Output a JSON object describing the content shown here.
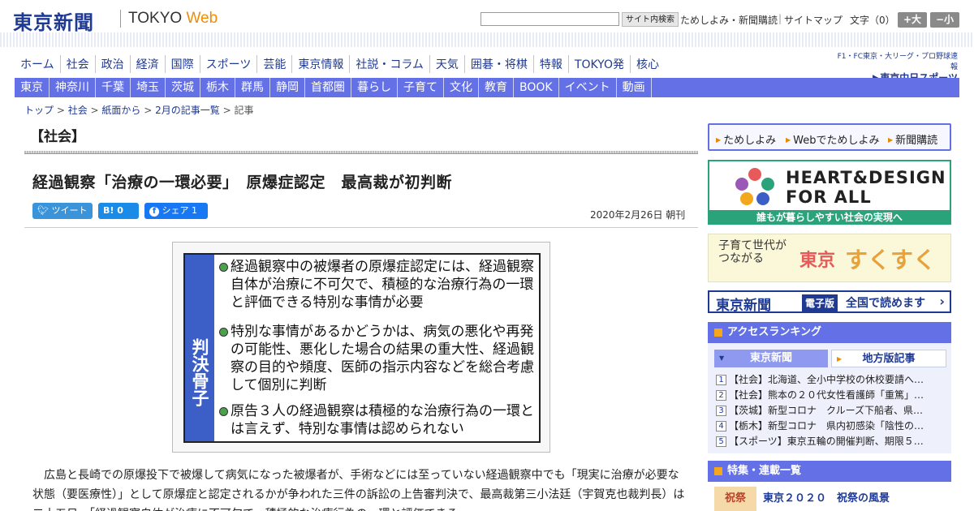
{
  "header": {
    "logo_jp": "東京新聞",
    "logo_en_prefix": "TOKYO ",
    "logo_en_suffix": "Web",
    "search_placeholder": "",
    "search_button": "サイト内検索",
    "links": [
      "ためしよみ・新聞購読",
      "サイトマップ"
    ],
    "font_size_label": "文字（0）",
    "font_plus": "+大",
    "font_minus": "−小"
  },
  "main_nav": [
    "ホーム",
    "社会",
    "政治",
    "経済",
    "国際",
    "スポーツ",
    "芸能",
    "東京情報",
    "社説・コラム",
    "天気",
    "囲碁・将棋",
    "特報",
    "TOKYO発",
    "核心"
  ],
  "chunichi": {
    "line1": "F1・FC東京・大リーグ・プロ野球速報",
    "line2": "▶東京中日スポーツ"
  },
  "sub_nav": [
    "東京",
    "神奈川",
    "千葉",
    "埼玉",
    "茨城",
    "栃木",
    "群馬",
    "静岡",
    "首都圏",
    "暮らし",
    "子育て",
    "文化",
    "教育",
    "BOOK",
    "イベント",
    "動画"
  ],
  "breadcrumb": [
    "トップ",
    "社会",
    "紙面から",
    "2月の記事一覧",
    "記事"
  ],
  "section_title": "【社会】",
  "article": {
    "headline": "経過観察「治療の一環必要」　原爆症認定　最高裁が初判断",
    "share": {
      "tweet": "ツイート",
      "hatena": "B! 0",
      "facebook": "シェア 1"
    },
    "date": "2020年2月26日 朝刊",
    "figure": {
      "side_label": "判決骨子",
      "points": [
        "経過観察中の被爆者の原爆症認定には、経過観察自体が治療に不可欠で、積極的な治療行為の一環と評価できる特別な事情が必要",
        "特別な事情があるかどうかは、病気の悪化や再発の可能性、悪化した場合の結果の重大性、経過観察の目的や頻度、医師の指示内容などを総合考慮して個別に判断",
        "原告３人の経過観察は積極的な治療行為の一環とは言えず、特別な事情は認められない"
      ]
    },
    "body": "　広島と長崎での原爆投下で被爆して病気になった被爆者が、手術などには至っていない経過観察中でも「現実に治療が必要な状態（要医療性）」として原爆症と認定されるかが争われた三件の訴訟の上告審判決で、最高裁第三小法廷（宇賀克也裁判長）は二十五日、「経過観察自体が治療に不可欠で、積極的な治療行為の一環と評価できる"
  },
  "rail": {
    "tameshi": [
      "ためしよみ",
      "Webでためしよみ",
      "新聞購読"
    ],
    "heart": {
      "title": "HEART&DESIGN FOR ALL",
      "caption": "誰もが暮らしやすい社会の実現へ"
    },
    "sukusuku": {
      "lead": "子育て世代が\nつながる",
      "tokyo": "東京",
      "main": "すくすく"
    },
    "denshi": {
      "name": "東京新聞",
      "badge": "電子版",
      "read": "全国で読めます"
    },
    "ranking": {
      "title": "アクセスランキング",
      "tab_active": "東京新聞",
      "tab_other": "地方版記事",
      "items": [
        "【社会】北海道、全小中学校の休校要請へ…",
        "【社会】熊本の２０代女性看護師「重篤」…",
        "【茨城】新型コロナ　クルーズ下船者、県…",
        "【栃木】新型コロナ　県内初感染「陰性の…",
        "【スポーツ】東京五輪の開催判断、期限５…"
      ]
    },
    "features": {
      "title": "特集・連載一覧",
      "thumb": "祝祭",
      "item": "東京２０２０　祝祭の風景"
    }
  },
  "colors": {
    "brand_blue": "#1f3a93",
    "nav_purple": "#6370e6",
    "accent_orange": "#f08c00",
    "green": "#2aa37a"
  }
}
